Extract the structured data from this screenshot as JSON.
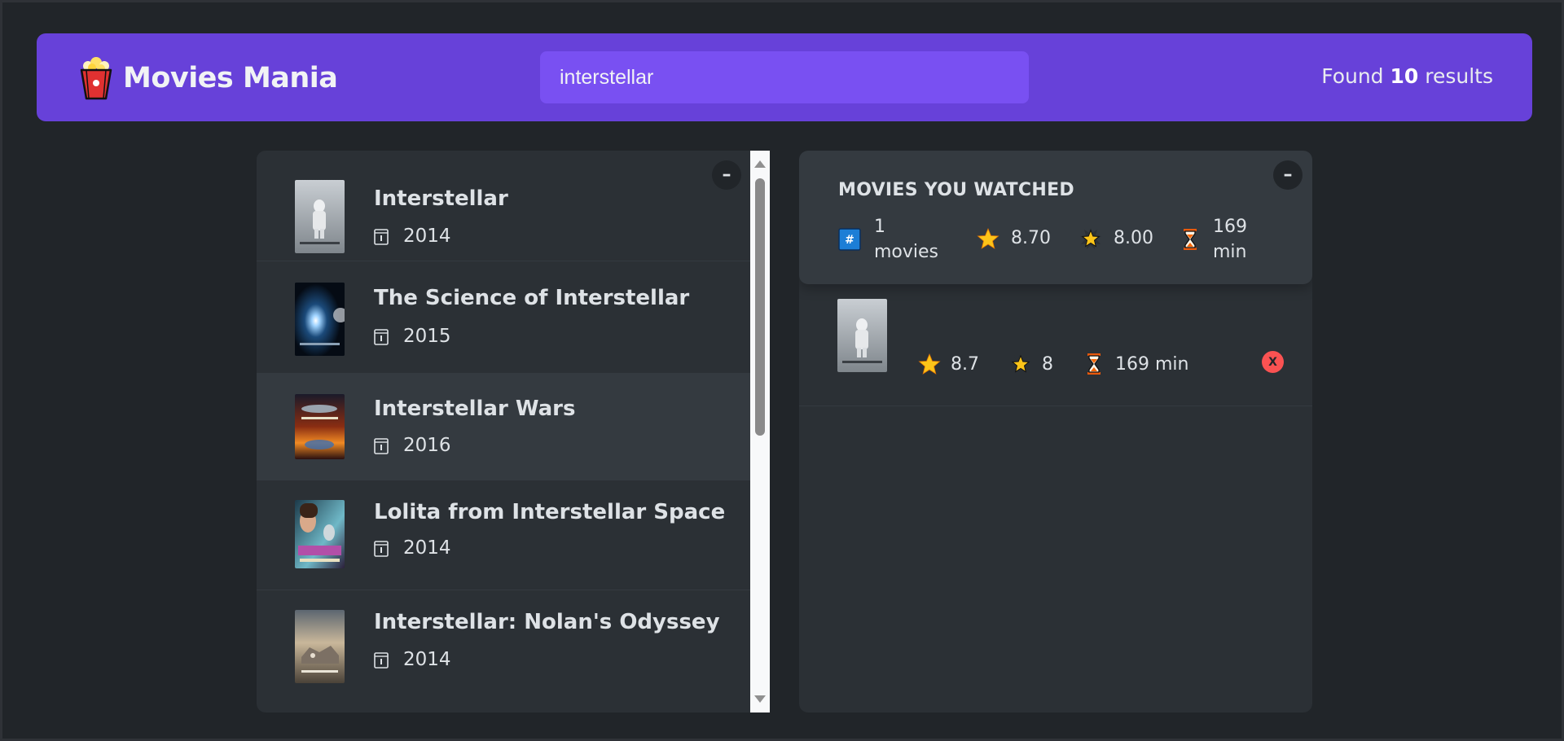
{
  "app": {
    "title": "Movies Mania"
  },
  "search": {
    "value": "interstellar"
  },
  "results": {
    "prefix": "Found ",
    "count": "10",
    "suffix": " results"
  },
  "list": {
    "toggle_label": "–",
    "movies": [
      {
        "title": "Interstellar",
        "year": "2014"
      },
      {
        "title": "The Science of Interstellar",
        "year": "2015"
      },
      {
        "title": "Interstellar Wars",
        "year": "2016"
      },
      {
        "title": "Lolita from Interstellar Space",
        "year": "2014"
      },
      {
        "title": "Interstellar: Nolan's Odyssey",
        "year": "2014"
      }
    ]
  },
  "watched": {
    "toggle_label": "–",
    "summary": {
      "title": "MOVIES YOU WATCHED",
      "count_line1": "1",
      "count_line2": "movies",
      "imdb_avg": "8.70",
      "user_avg": "8.00",
      "runtime_line1": "169",
      "runtime_line2": "min"
    },
    "movies": [
      {
        "imdb_rating": "8.7",
        "user_rating": "8",
        "runtime": "169 min",
        "delete_label": "X"
      }
    ]
  },
  "icons": {
    "logo": "popcorn-icon",
    "year": "calendar-icon",
    "count": "hash-icon",
    "imdb": "star-icon",
    "user": "glowing-star-icon",
    "runtime": "hourglass-icon"
  },
  "colors": {
    "nav": "#6741d9",
    "search": "#7950f2",
    "background": "#212529",
    "panel": "#2b3035",
    "summary": "#343a40",
    "delete": "#fa5252"
  }
}
